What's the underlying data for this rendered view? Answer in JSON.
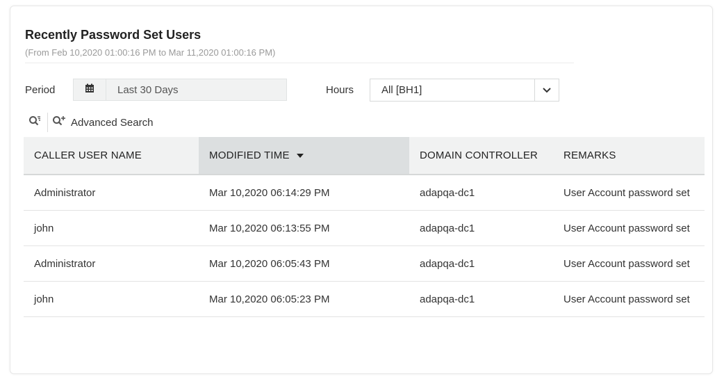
{
  "report": {
    "title": "Recently Password Set Users",
    "subtitle": "(From Feb 10,2020 01:00:16 PM to Mar 11,2020 01:00:16 PM)"
  },
  "filters": {
    "period_label": "Period",
    "period_icon": "calendar-icon",
    "period_value": "Last 30 Days",
    "hours_label": "Hours",
    "hours_value": "All [BH1]",
    "hours_icon": "chevron-down-icon"
  },
  "search": {
    "quick_search_icon": "search-filter-icon",
    "advanced_icon": "search-plus-icon",
    "advanced_label": "Advanced Search"
  },
  "table": {
    "columns": [
      {
        "label": "CALLER USER NAME"
      },
      {
        "label": "MODIFIED TIME",
        "sorted": "descending"
      },
      {
        "label": "DOMAIN CONTROLLER"
      },
      {
        "label": "REMARKS"
      }
    ],
    "rows": [
      [
        "Administrator",
        "Mar 10,2020 06:14:29 PM",
        "adapqa-dc1",
        "User Account password set"
      ],
      [
        "john",
        "Mar 10,2020 06:13:55 PM",
        "adapqa-dc1",
        "User Account password set"
      ],
      [
        "Administrator",
        "Mar 10,2020 06:05:43 PM",
        "adapqa-dc1",
        "User Account password set"
      ],
      [
        "john",
        "Mar 10,2020 06:05:23 PM",
        "adapqa-dc1",
        "User Account password set"
      ]
    ]
  },
  "colors": {
    "header_bg": "#f1f2f2",
    "sorted_header_bg": "#dcdfe0",
    "subtitle_text": "#9a9a9a"
  }
}
